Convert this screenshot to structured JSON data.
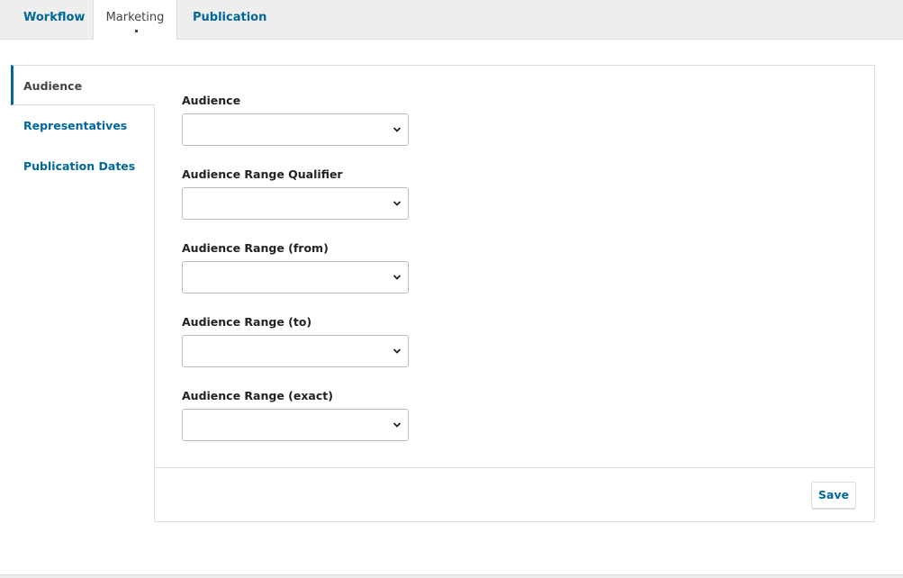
{
  "tabs": [
    {
      "label": "Workflow"
    },
    {
      "label": "Marketing"
    },
    {
      "label": "Publication"
    }
  ],
  "sidebar": {
    "items": [
      {
        "label": "Audience"
      },
      {
        "label": "Representatives"
      },
      {
        "label": "Publication Dates"
      }
    ]
  },
  "form": {
    "fields": [
      {
        "label": "Audience",
        "value": ""
      },
      {
        "label": "Audience Range Qualifier",
        "value": ""
      },
      {
        "label": "Audience Range (from)",
        "value": ""
      },
      {
        "label": "Audience Range (to)",
        "value": ""
      },
      {
        "label": "Audience Range (exact)",
        "value": ""
      }
    ],
    "save_label": "Save"
  },
  "colors": {
    "link": "#006798",
    "text": "#222222",
    "border": "#dddddd",
    "topbar": "#eeeeee"
  },
  "icons": {
    "select_indicator": "chevron-down-icon"
  }
}
